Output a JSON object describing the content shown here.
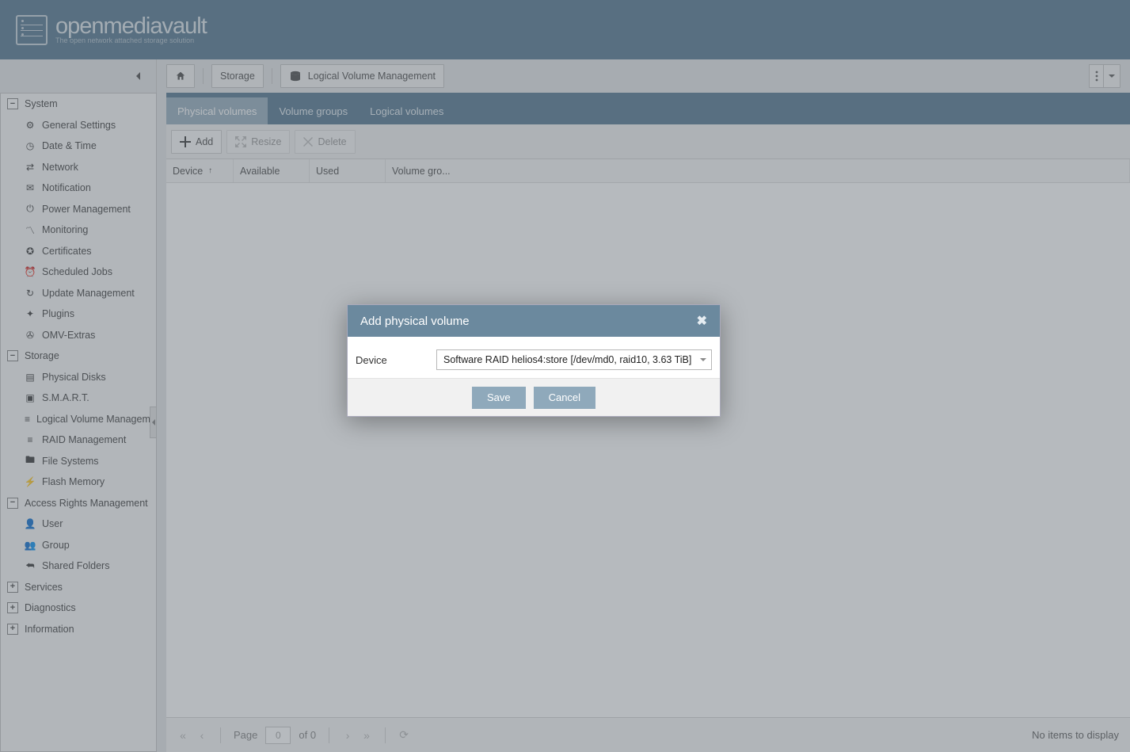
{
  "brand": {
    "name": "openmediavault",
    "tagline": "The open network attached storage solution"
  },
  "breadcrumb": {
    "home": "⌂",
    "lvl1": "Storage",
    "lvl2": "Logical Volume Management"
  },
  "sidebar": {
    "sections": [
      {
        "label": "System",
        "state": "−",
        "items": [
          "General Settings",
          "Date & Time",
          "Network",
          "Notification",
          "Power Management",
          "Monitoring",
          "Certificates",
          "Scheduled Jobs",
          "Update Management",
          "Plugins",
          "OMV-Extras"
        ]
      },
      {
        "label": "Storage",
        "state": "−",
        "items": [
          "Physical Disks",
          "S.M.A.R.T.",
          "Logical Volume Management",
          "RAID Management",
          "File Systems",
          "Flash Memory"
        ]
      },
      {
        "label": "Access Rights Management",
        "state": "−",
        "items": [
          "User",
          "Group",
          "Shared Folders"
        ]
      },
      {
        "label": "Services",
        "state": "+",
        "items": []
      },
      {
        "label": "Diagnostics",
        "state": "+",
        "items": []
      },
      {
        "label": "Information",
        "state": "+",
        "items": []
      }
    ]
  },
  "tabs": [
    "Physical volumes",
    "Volume groups",
    "Logical volumes"
  ],
  "active_tab": 0,
  "toolbar": {
    "add": "Add",
    "resize": "Resize",
    "delete": "Delete"
  },
  "columns": [
    "Device",
    "Available",
    "Used",
    "Volume gro..."
  ],
  "pager": {
    "label_page": "Page",
    "current": "0",
    "of": "of 0",
    "status": "No items to display"
  },
  "dialog": {
    "title": "Add physical volume",
    "field_label": "Device",
    "value": "Software RAID helios4:store [/dev/md0, raid10, 3.63 TiB]",
    "save": "Save",
    "cancel": "Cancel"
  }
}
